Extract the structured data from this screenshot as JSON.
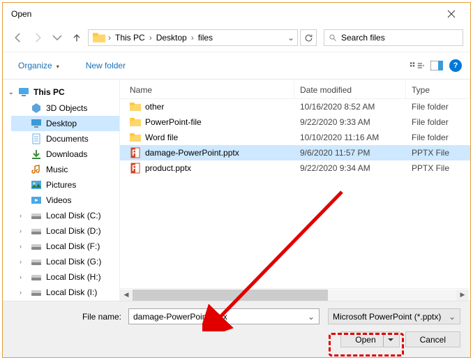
{
  "dialog": {
    "title": "Open"
  },
  "breadcrumb": {
    "seg1": "This PC",
    "seg2": "Desktop",
    "seg3": "files"
  },
  "search": {
    "placeholder": "Search files"
  },
  "commandbar": {
    "organize": "Organize",
    "newfolder": "New folder"
  },
  "tree": {
    "root": "This PC",
    "items": [
      "3D Objects",
      "Desktop",
      "Documents",
      "Downloads",
      "Music",
      "Pictures",
      "Videos",
      "Local Disk (C:)",
      "Local Disk (D:)",
      "Local Disk (F:)",
      "Local Disk (G:)",
      "Local Disk (H:)",
      "Local Disk (I:)"
    ]
  },
  "columns": {
    "name": "Name",
    "date": "Date modified",
    "type": "Type"
  },
  "files": [
    {
      "name": "other",
      "date": "10/16/2020 8:52 AM",
      "type": "File folder",
      "kind": "folder"
    },
    {
      "name": "PowerPoint-file",
      "date": "9/22/2020 9:33 AM",
      "type": "File folder",
      "kind": "folder"
    },
    {
      "name": "Word file",
      "date": "10/10/2020 11:16 AM",
      "type": "File folder",
      "kind": "folder"
    },
    {
      "name": "damage-PowerPoint.pptx",
      "date": "9/6/2020 11:57 PM",
      "type": "PPTX File",
      "kind": "pptx"
    },
    {
      "name": "product.pptx",
      "date": "9/22/2020 9:34 AM",
      "type": "PPTX File",
      "kind": "pptx"
    }
  ],
  "filename": {
    "label": "File name:",
    "value": "damage-PowerPoint.pptx"
  },
  "filter": {
    "value": "Microsoft PowerPoint (*.pptx)"
  },
  "buttons": {
    "open": "Open",
    "cancel": "Cancel"
  }
}
